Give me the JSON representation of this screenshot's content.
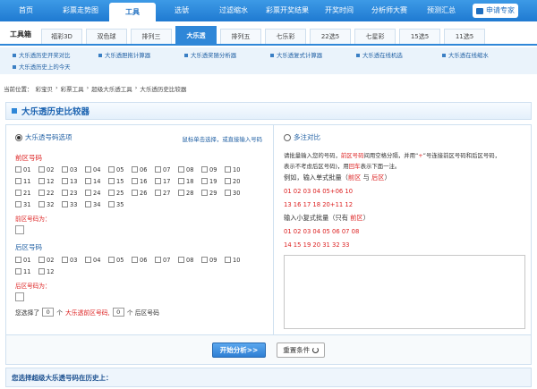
{
  "topnav": {
    "items": [
      "首页",
      "彩票走势图",
      "工具",
      "选號",
      "过滤缩水",
      "彩票开奖结果",
      "开奖时间",
      "分析师大赛",
      "预测汇总"
    ],
    "apply_label": "申请专家"
  },
  "tabs": {
    "title": "工具箱",
    "items": [
      "福彩3D",
      "双色球",
      "排列三",
      "大乐透",
      "排列五",
      "七乐彩",
      "22选5",
      "七星彩",
      "15选5",
      "11选5"
    ]
  },
  "links": {
    "row1": [
      "大乐透历史开奖对比",
      "大乐透胆拖计算器",
      "大乐透奖随分析器",
      "大乐透复式计算器",
      "大乐透在线机选",
      "大乐透在线缩水"
    ],
    "row2": [
      "大乐透历史上的今天"
    ]
  },
  "breadcrumb": [
    "当前位置：",
    "彩宝贝",
    "›",
    "彩票工具",
    "›",
    "超级大乐透工具",
    "›",
    "大乐透历史比较器"
  ],
  "page_title": "大乐透历史比较器",
  "left": {
    "option_label": "大乐透号码选项",
    "hint": "鼠标单击选择，或直接输入号码",
    "front_title": "前区号码",
    "front_numbers": [
      "01",
      "02",
      "03",
      "04",
      "05",
      "06",
      "07",
      "08",
      "09",
      "10",
      "11",
      "12",
      "13",
      "14",
      "15",
      "16",
      "17",
      "18",
      "19",
      "20",
      "21",
      "22",
      "23",
      "24",
      "25",
      "26",
      "27",
      "28",
      "29",
      "30",
      "31",
      "32",
      "33",
      "34",
      "35"
    ],
    "front_label": "前区号码为：",
    "back_title": "后区号码",
    "back_numbers": [
      "01",
      "02",
      "03",
      "04",
      "05",
      "06",
      "07",
      "08",
      "09",
      "10",
      "11",
      "12"
    ],
    "back_label": "后区号码为：",
    "sel_prefix": "您选择了",
    "front_count": "0",
    "sel_mid": "个",
    "sel_mid_red": "大乐透前区号码,",
    "back_count": "0",
    "sel_suffix": "个 后区号码"
  },
  "right": {
    "option_label": "多注对比",
    "desc_p1": "请批量输入您的号码，",
    "desc_red1": "前区号码",
    "desc_p2": "间用空格分隔，并用“",
    "desc_red2": "+",
    "desc_p3": "”号连接前区号码和后区号码，",
    "desc_line2_p1": "表示不考虑后区号码)，用",
    "desc_line2_red": "回车",
    "desc_line2_p2": "表示下面一注。",
    "example_label": "例如，输入单式批量（",
    "example_front": "前区",
    "example_and": " 与 ",
    "example_back": "后区",
    "example_end": "）",
    "ex1": "01 02 03 04 05+06 10",
    "ex2": "13 16 17 18 20+11 12",
    "example2_label": "输入小复式批量（只有 ",
    "example2_red": "前区",
    "example2_end": "）",
    "ex3": "01 02 03 04 05 06 07 08",
    "ex4": "14 15 19 20 31 32 33"
  },
  "buttons": {
    "start": "开始分析>>",
    "reset": "重置条件"
  },
  "bottom_title": "您选择超级大乐透号码在历史上："
}
